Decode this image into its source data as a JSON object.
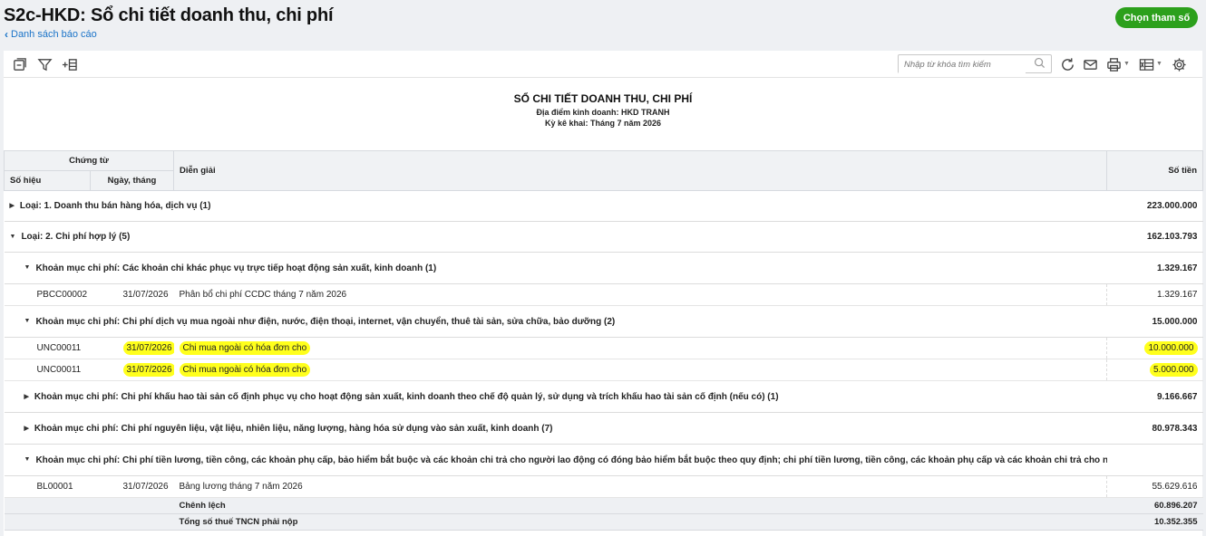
{
  "header": {
    "title": "S2c-HKD: Sổ chi tiết doanh thu, chi phí",
    "back_link": "Danh sách báo cáo",
    "param_button": "Chọn tham số"
  },
  "toolbar": {
    "search_placeholder": "Nhập từ khóa tìm kiếm",
    "icons": [
      "collapse-icon",
      "filter-icon",
      "add-column-icon",
      "refresh-icon",
      "mail-icon",
      "print-icon",
      "excel-icon",
      "settings-icon"
    ]
  },
  "report": {
    "title": "SỔ CHI TIẾT DOANH THU, CHI PHÍ",
    "location": "Địa điểm kinh doanh: HKD TRANH",
    "period": "Kỳ kê khai: Tháng 7 năm 2026"
  },
  "columns": {
    "voucher_group": "Chứng từ",
    "number": "Số hiệu",
    "date": "Ngày, tháng",
    "description": "Diễn giải",
    "amount": "Số tiền"
  },
  "rows": [
    {
      "kind": "group",
      "level": 0,
      "expanded": false,
      "label": "Loại: 1. Doanh thu bán hàng hóa, dịch vụ (1)",
      "amount": "223.000.000"
    },
    {
      "kind": "group",
      "level": 0,
      "expanded": true,
      "label": "Loại: 2. Chi phí hợp lý (5)",
      "amount": "162.103.793"
    },
    {
      "kind": "group",
      "level": 1,
      "expanded": true,
      "label": "Khoản mục chi phí: Các khoản chi khác phục vụ trực tiếp hoạt động sản xuất, kinh doanh (1)",
      "amount": "1.329.167"
    },
    {
      "kind": "detail",
      "number": "PBCC00002",
      "date": "31/07/2026",
      "description": "Phân bổ chi phí CCDC tháng 7 năm 2026",
      "amount": "1.329.167",
      "highlight": false
    },
    {
      "kind": "group",
      "level": 1,
      "expanded": true,
      "label": "Khoản mục chi phí: Chi phí dịch vụ mua ngoài như điện, nước, điện thoại, internet, vận chuyển, thuê tài sản, sửa chữa, bảo dưỡng (2)",
      "amount": "15.000.000"
    },
    {
      "kind": "detail",
      "number": "UNC00011",
      "date": "31/07/2026",
      "description": "Chi mua ngoài có hóa đơn cho",
      "amount": "10.000.000",
      "highlight": true
    },
    {
      "kind": "detail",
      "number": "UNC00011",
      "date": "31/07/2026",
      "description": "Chi mua ngoài có hóa đơn cho",
      "amount": "5.000.000",
      "highlight": true
    },
    {
      "kind": "group",
      "level": 1,
      "expanded": false,
      "label": "Khoản mục chi phí: Chi phí khấu hao tài sản cố định phục vụ cho hoạt động sản xuất, kinh doanh theo chế độ quản lý, sử dụng và trích khấu hao tài sản cố định (nếu có) (1)",
      "amount": "9.166.667"
    },
    {
      "kind": "group",
      "level": 1,
      "expanded": false,
      "label": "Khoản mục chi phí: Chi phí nguyên liệu, vật liệu, nhiên liệu, năng lượng, hàng hóa sử dụng vào sản xuất, kinh doanh (7)",
      "amount": "80.978.343"
    },
    {
      "kind": "group",
      "level": 1,
      "expanded": true,
      "label": "Khoản mục chi phí: Chi phí tiền lương, tiền công, các khoản phụ cấp, bảo hiểm bắt buộc và các khoản chi trả cho người lao động có đóng bảo hiểm bắt buộc theo quy định; chi phí tiền lương, tiền công, các khoản phụ cấp và các khoản chi trả cho người lao động dướ",
      "amount": ""
    },
    {
      "kind": "detail",
      "number": "BL00001",
      "date": "31/07/2026",
      "description": "Bảng lương tháng 7 năm 2026",
      "amount": "55.629.616",
      "highlight": false
    }
  ],
  "totals": [
    {
      "label": "Chênh lệch",
      "amount": "60.896.207"
    },
    {
      "label": "Tổng số thuế TNCN phải nộp",
      "amount": "10.352.355"
    }
  ],
  "colors": {
    "accent": "#2ca01c",
    "link": "#1a73c8",
    "highlight": "#ffff1c"
  }
}
